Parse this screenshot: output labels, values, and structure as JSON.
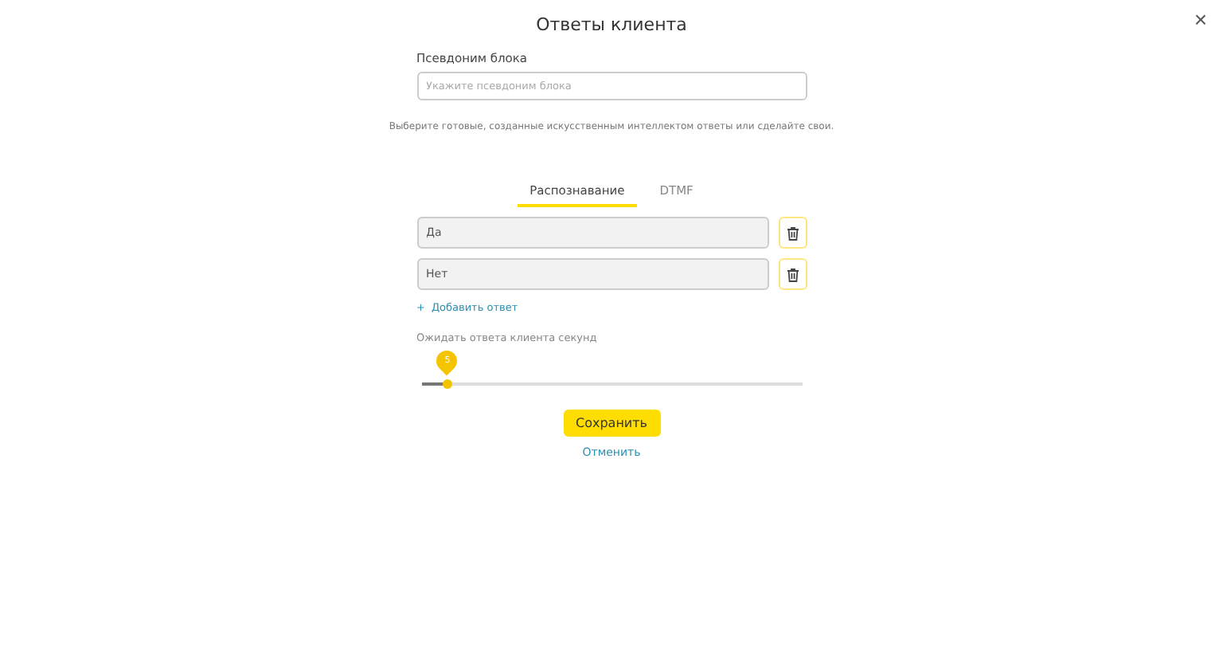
{
  "title": "Ответы клиента",
  "close": "×",
  "alias": {
    "label": "Псевдоним блока",
    "placeholder": "Укажите псевдоним блока"
  },
  "hint": "Выберите готовые, созданные искусственным интеллектом ответы или сделайте свои.",
  "tabs": [
    {
      "label": "Распознавание",
      "selected": true
    },
    {
      "label": "DTMF",
      "selected": false
    }
  ],
  "answers": [
    {
      "value": "Да"
    },
    {
      "value": "Нет"
    }
  ],
  "add_answer": {
    "icon": "+",
    "label": "Добавить ответ"
  },
  "timeout": {
    "label": "Ожидать ответа клиента секунд",
    "value": "5",
    "level": 0.067
  },
  "buttons": {
    "save": "Сохранить",
    "cancel": "Отменить"
  }
}
